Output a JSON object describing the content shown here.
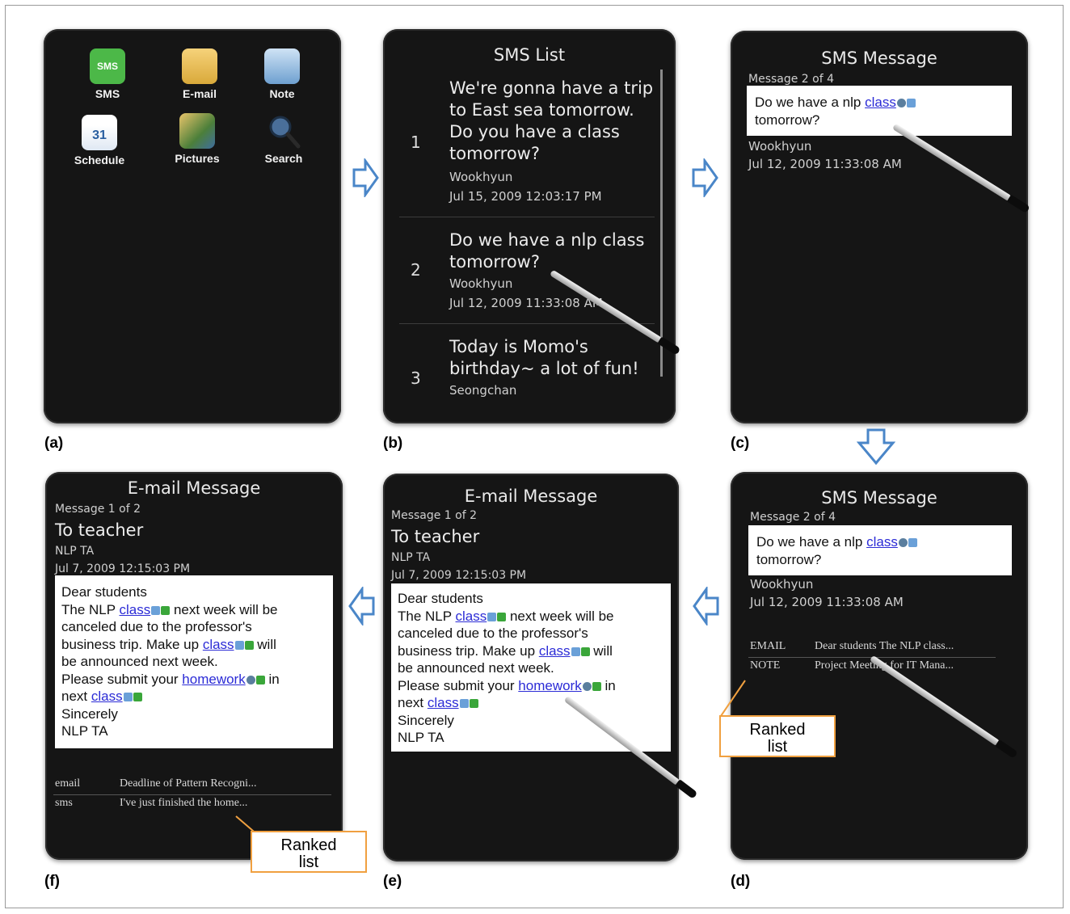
{
  "captions": {
    "a": "(a)",
    "b": "(b)",
    "c": "(c)",
    "d": "(d)",
    "e": "(e)",
    "f": "(f)"
  },
  "panel_a": {
    "apps": [
      {
        "label": "SMS",
        "icon": "sms-icon",
        "badge": "SMS"
      },
      {
        "label": "E-mail",
        "icon": "email-icon"
      },
      {
        "label": "Note",
        "icon": "note-icon"
      },
      {
        "label": "Schedule",
        "icon": "calendar-icon",
        "badge": "31"
      },
      {
        "label": "Pictures",
        "icon": "pictures-icon"
      },
      {
        "label": "Search",
        "icon": "magnifier-icon"
      }
    ]
  },
  "panel_b": {
    "title": "SMS List",
    "rows": [
      {
        "num": "1",
        "text": "We're gonna have a trip to East sea tomorrow. Do you have a class tomorrow?",
        "sender": "Wookhyun",
        "date": "Jul 15, 2009 12:03:17 PM"
      },
      {
        "num": "2",
        "text": "Do we have a nlp class tomorrow?",
        "sender": "Wookhyun",
        "date": "Jul 12, 2009 11:33:08 AM"
      },
      {
        "num": "3",
        "text": "Today is Momo's birthday~ a lot of fun!",
        "sender": "Seongchan"
      }
    ]
  },
  "sms_message": {
    "title": "SMS Message",
    "counter": "Message 2 of 4",
    "body_before": "Do we have a nlp ",
    "body_link": "class",
    "body_after": "tomorrow?",
    "sender": "Wookhyun",
    "date": "Jul 12, 2009 11:33:08 AM"
  },
  "panel_d": {
    "ranked": [
      {
        "type": "EMAIL",
        "text": "Dear students The NLP class..."
      },
      {
        "type": "NOTE",
        "text": "Project Meeting for IT Mana..."
      }
    ],
    "callout_line1": "Ranked",
    "callout_line2": "list"
  },
  "email_message": {
    "title": "E-mail Message",
    "counter": "Message 1 of 2",
    "subject": "To teacher",
    "from": "NLP TA",
    "date": "Jul 7, 2009 12:15:03 PM",
    "l1": "Dear students",
    "l2a": "The NLP ",
    "l2link": "class",
    "l2b": " next week will be",
    "l3": "canceled due to the professor's",
    "l4a": "business trip. Make up ",
    "l4link": "class",
    "l4b": " will",
    "l5": "be announced next week.",
    "l6a": "Please submit your ",
    "l6link": "homework",
    "l6b": " in",
    "l7a": "next ",
    "l7link": "class",
    "l8": "Sincerely",
    "l9": "NLP TA"
  },
  "panel_f": {
    "ranked": [
      {
        "type": "email",
        "text": "Deadline of Pattern Recogni..."
      },
      {
        "type": "sms",
        "text": "I've just finished the home..."
      }
    ],
    "callout_line1": "Ranked",
    "callout_line2": "list"
  }
}
